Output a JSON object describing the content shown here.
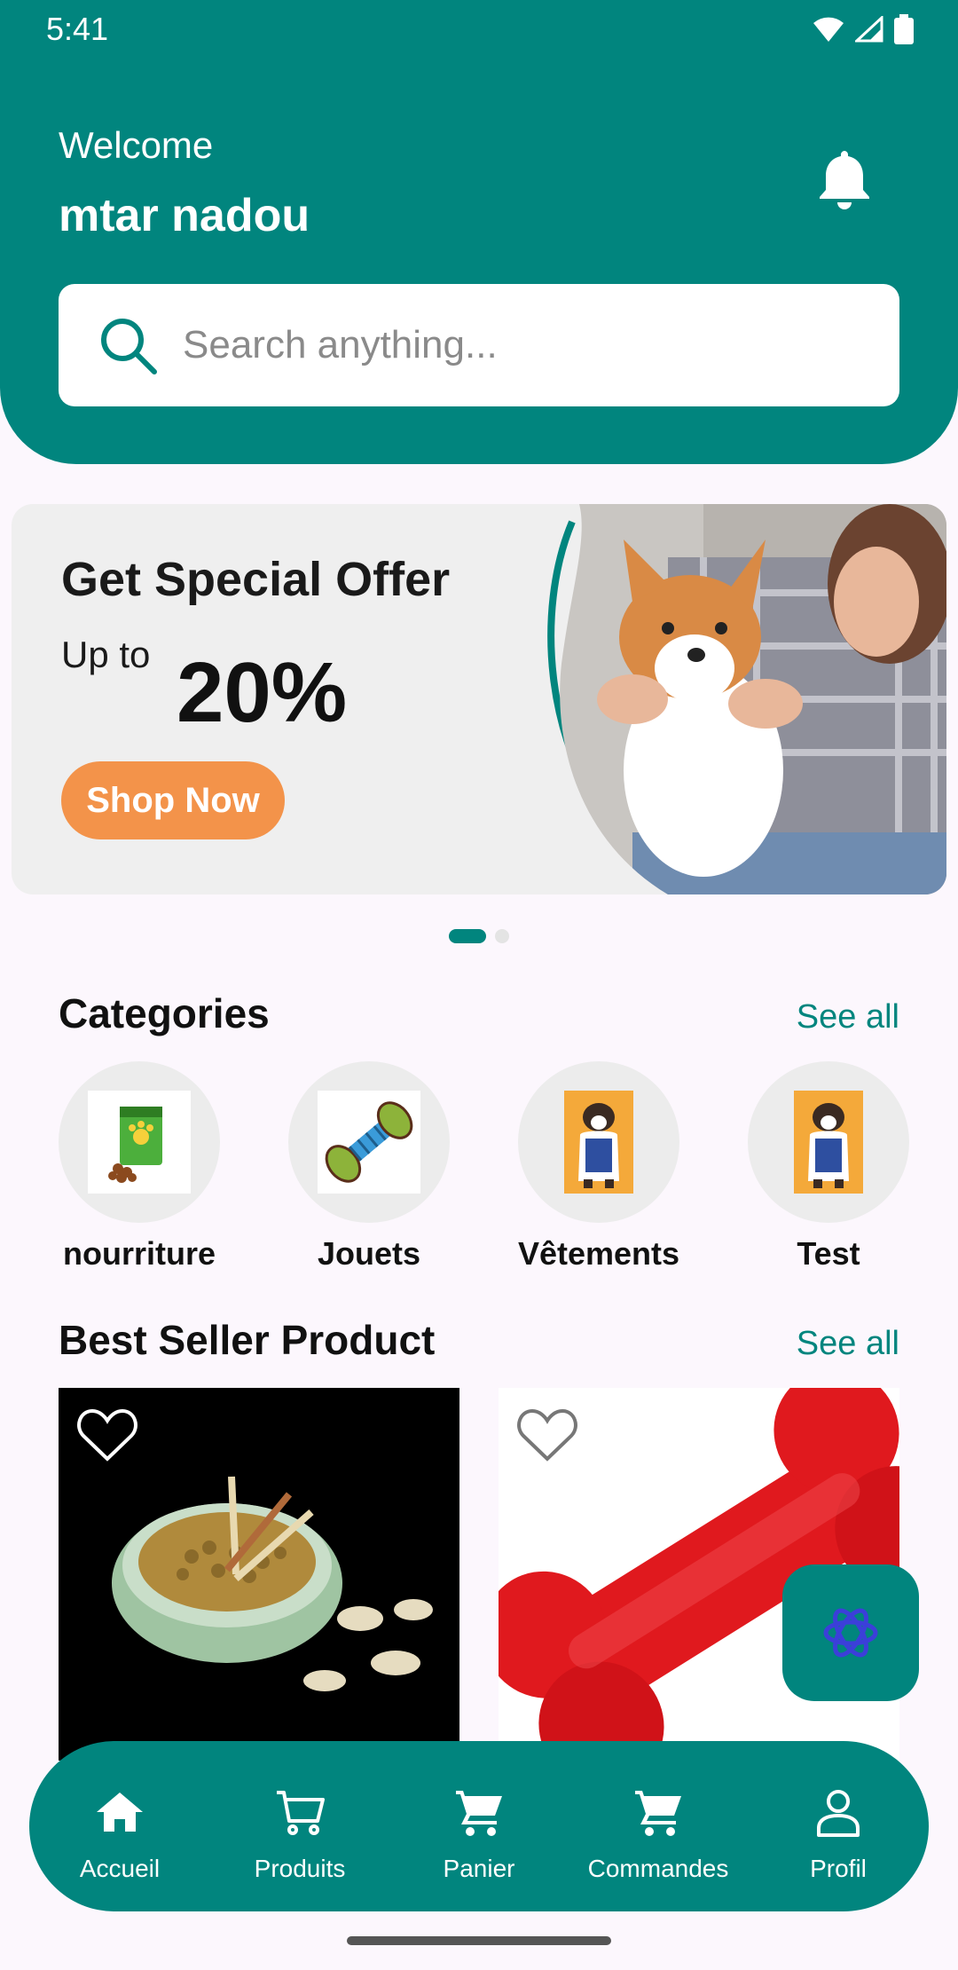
{
  "status_bar": {
    "time": "5:41"
  },
  "header": {
    "welcome": "Welcome",
    "username": "mtar nadou"
  },
  "search": {
    "placeholder": "Search anything..."
  },
  "banner": {
    "title": "Get Special Offer",
    "upto": "Up to",
    "discount": "20%",
    "cta": "Shop Now",
    "slide_count": 2,
    "active_slide": 1
  },
  "categories": {
    "title": "Categories",
    "see_all": "See all",
    "items": [
      {
        "label": "nourriture",
        "icon": "pet-food-bag-icon"
      },
      {
        "label": "Jouets",
        "icon": "chew-toy-icon"
      },
      {
        "label": "Vêtements",
        "icon": "dog-clothes-icon"
      },
      {
        "label": "Test",
        "icon": "dog-clothes-icon"
      }
    ]
  },
  "best_seller": {
    "title": "Best Seller Product",
    "see_all": "See all",
    "products": [
      {
        "image": "food-bowl-with-chews"
      },
      {
        "image": "red-rubber-bone-toy"
      }
    ]
  },
  "bottom_nav": {
    "items": [
      {
        "label": "Accueil",
        "icon": "home-icon",
        "active": true
      },
      {
        "label": "Produits",
        "icon": "cart-outline-icon"
      },
      {
        "label": "Panier",
        "icon": "cart-icon"
      },
      {
        "label": "Commandes",
        "icon": "cart-icon"
      },
      {
        "label": "Profil",
        "icon": "person-icon"
      }
    ]
  },
  "colors": {
    "primary": "#01857E",
    "accent_orange": "#F3934A",
    "background": "#FCF7FD"
  }
}
